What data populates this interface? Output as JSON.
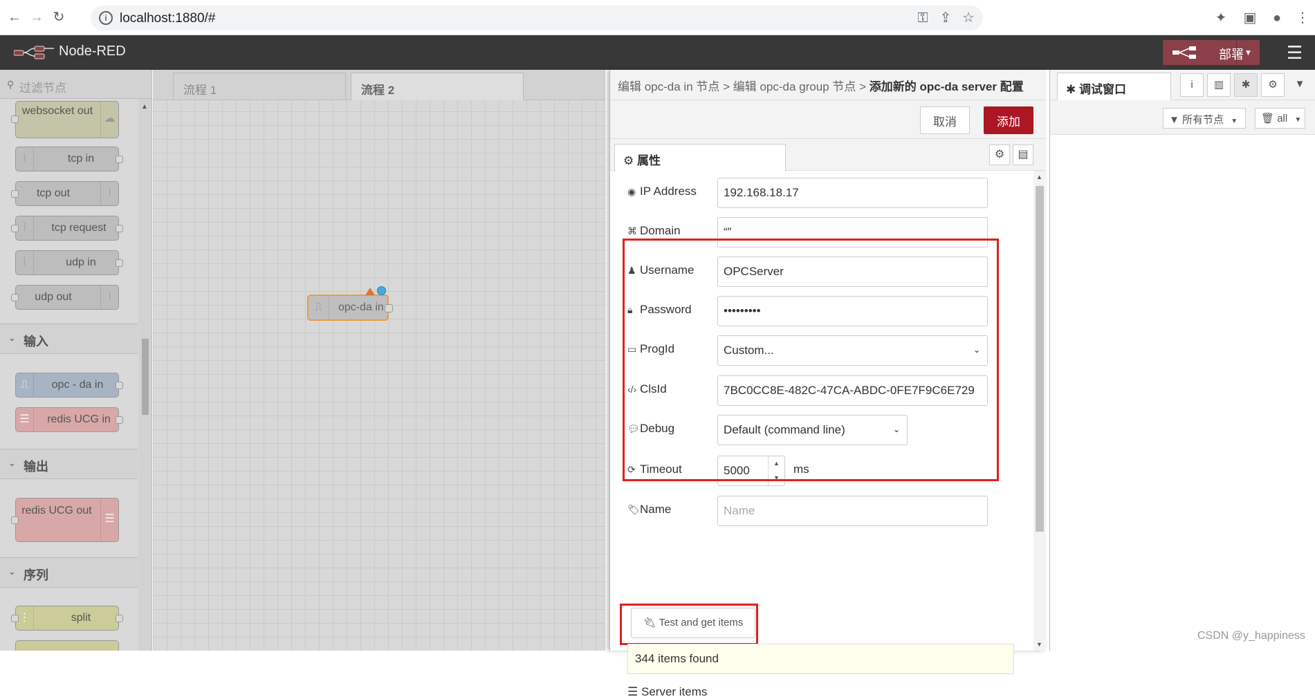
{
  "browser": {
    "url": "localhost:1880/#"
  },
  "app": {
    "title": "Node-RED",
    "deploy_label": "部署"
  },
  "palette": {
    "search_placeholder": "过滤节点",
    "nodes_network": [
      {
        "label": "websocket out"
      },
      {
        "label": "tcp in"
      },
      {
        "label": "tcp out"
      },
      {
        "label": "tcp request"
      },
      {
        "label": "udp in"
      },
      {
        "label": "udp out"
      }
    ],
    "category_input": "输入",
    "nodes_input": [
      {
        "label": "opc - da in"
      },
      {
        "label": "redis UCG in"
      }
    ],
    "category_output": "输出",
    "nodes_output": [
      {
        "label": "redis UCG out"
      }
    ],
    "category_sequence": "序列",
    "nodes_sequence": [
      {
        "label": "split"
      }
    ]
  },
  "workspace": {
    "tabs": [
      "流程 1",
      "流程 2"
    ],
    "node_label": "opc-da in"
  },
  "editor": {
    "breadcrumb_part1": "编辑 opc-da in 节点 > 编辑 opc-da group 节点 > ",
    "breadcrumb_current": "添加新的 opc-da server 配置",
    "cancel_label": "取消",
    "add_label": "添加",
    "props_tab_label": "属性",
    "fields": {
      "ip_label": "IP Address",
      "ip_value": "192.168.18.17",
      "domain_label": "Domain",
      "domain_value": "“”",
      "username_label": "Username",
      "username_value": "OPCServer",
      "password_label": "Password",
      "password_value": "•••••••••",
      "progid_label": "ProgId",
      "progid_value": "Custom...",
      "clsid_label": "ClsId",
      "clsid_value": "7BC0CC8E-482C-47CA-ABDC-0FE7F9C6E729",
      "debug_label": "Debug",
      "debug_value": "Default (command line)",
      "timeout_label": "Timeout",
      "timeout_value": "5000",
      "timeout_unit": "ms",
      "name_label": "Name",
      "name_placeholder": "Name"
    },
    "test_button_label": "Test and get items",
    "result_text": "344 items found",
    "server_items_label": "Server items"
  },
  "sidebar": {
    "debug_tab_label": "调试窗口",
    "filter_label": "所有节点",
    "clear_label": "all"
  },
  "watermark": "CSDN @y_happiness",
  "colors": {
    "deploy": "#8b4049",
    "add_button": "#ad1625",
    "highlight": "#e02020"
  }
}
